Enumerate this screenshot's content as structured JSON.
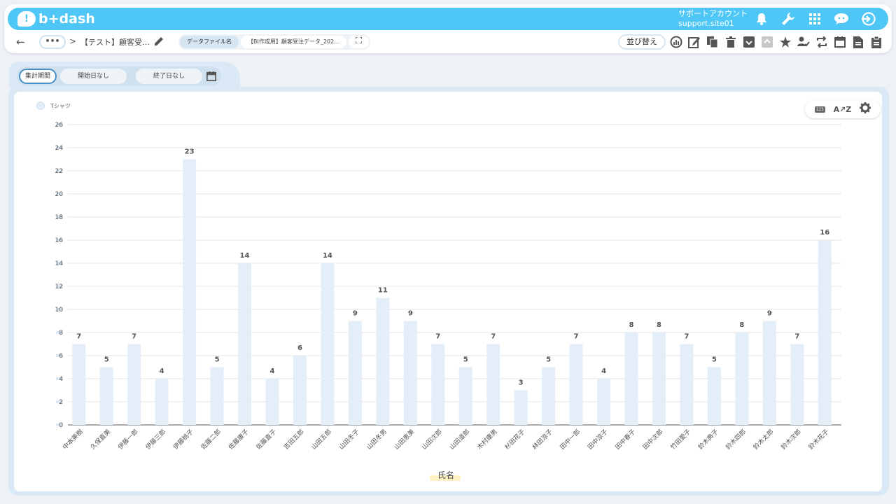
{
  "app": {
    "logo_text": "b+dash",
    "account_label": "サポートアカウント",
    "account_site": "support.site01"
  },
  "toolbar": {
    "more_label": "•••",
    "breadcrumb_sep": ">",
    "report_title": "【テスト】顧客受…",
    "file_chip_head": "データファイル名",
    "file_chip_name": "【BI作成用】顧客受注データ_202…",
    "sort_label": "並び替え"
  },
  "filters": {
    "period_label": "集計期間",
    "start_label": "開始日なし",
    "tilde": "~",
    "end_label": "終了日なし"
  },
  "icons": {
    "appbar": [
      "bell-icon",
      "wrench-icon",
      "apps-grid-icon",
      "chat-bubble-icon",
      "logout-icon"
    ],
    "toolbar": [
      "chart-type-icon",
      "edit-note-icon",
      "copy-icon",
      "trash-icon",
      "archive-down-icon",
      "archive-disabled-icon",
      "star-icon",
      "user-check-icon",
      "swap-icon",
      "calendar-icon",
      "document-icon",
      "clipboard-icon"
    ]
  },
  "colors": {
    "accent": "#4ec7f6",
    "bar": "#e3eef8",
    "axis": "#555555"
  },
  "chart_data": {
    "type": "bar",
    "series": [
      {
        "name": "Tシャツ",
        "values": [
          7,
          5,
          7,
          4,
          23,
          5,
          14,
          4,
          6,
          14,
          9,
          11,
          9,
          7,
          5,
          7,
          3,
          5,
          7,
          4,
          8,
          8,
          7,
          5,
          8,
          9,
          7,
          16
        ]
      }
    ],
    "categories": [
      "中本美樹",
      "久保直美",
      "伊藤一郎",
      "伊藤三郎",
      "伊藤桃子",
      "佐藤二郎",
      "佐藤康子",
      "佐藤直子",
      "吉田五郎",
      "山田五郎",
      "山田冬子",
      "山田冬男",
      "山田恵美",
      "山田次郎",
      "山田道郎",
      "木村康男",
      "杉田花子",
      "林田涼子",
      "田中一郎",
      "田中涼子",
      "田中春子",
      "田中次郎",
      "竹田愛子",
      "鈴木典子",
      "鈴木四郎",
      "鈴木太郎",
      "鈴木次郎",
      "鈴木花子"
    ],
    "xlabel": "氏名",
    "ylabel": "",
    "ylim": [
      0,
      26
    ],
    "yticks": [
      0,
      2,
      4,
      6,
      8,
      10,
      12,
      14,
      16,
      18,
      20,
      22,
      24,
      26
    ],
    "grid": true,
    "legend": "top-left",
    "data_labels": true
  }
}
